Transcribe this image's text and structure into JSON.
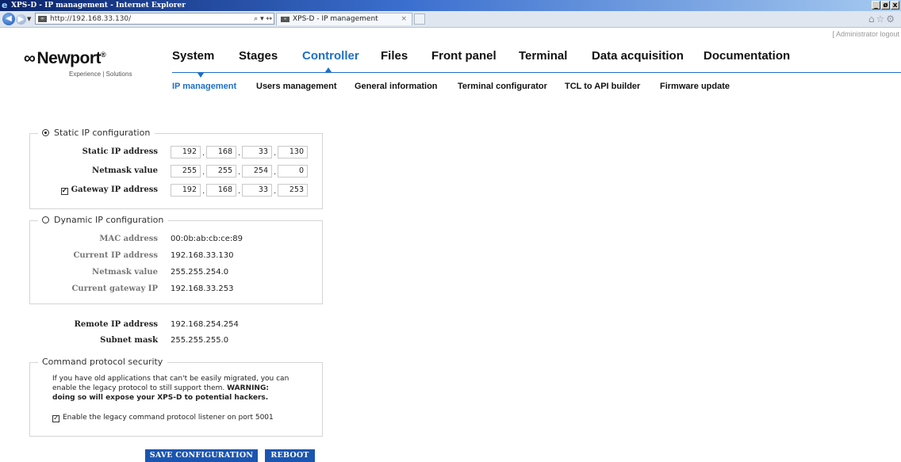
{
  "window": {
    "title": "XPS-D - IP management - Internet Explorer",
    "controls": [
      "_",
      "ø",
      "x"
    ]
  },
  "browser": {
    "address": "http://192.168.33.130/",
    "address_tools": "⌕ ▾ ↔",
    "tab_label": "XPS-D - IP management",
    "tab_close": "×",
    "right_icons": "⌂☆⚙"
  },
  "header": {
    "logout": "[ Administrator logout",
    "logo_text": "Newport",
    "logo_symbol": "∞",
    "logo_reg": "®",
    "tagline": "Experience | Solutions"
  },
  "topnav": [
    "System",
    "Stages",
    "Controller",
    "Files",
    "Front panel",
    "Terminal",
    "Data acquisition",
    "Documentation"
  ],
  "topnav_active": "Controller",
  "subnav": [
    "IP management",
    "Users management",
    "General information",
    "Terminal configurator",
    "TCL to API builder",
    "Firmware update"
  ],
  "subnav_active": "IP management",
  "static": {
    "legend": "Static IP configuration",
    "selected": true,
    "ip_label": "Static IP address",
    "ip": [
      "192",
      "168",
      "33",
      "130"
    ],
    "netmask_label": "Netmask value",
    "netmask": [
      "255",
      "255",
      "254",
      "0"
    ],
    "gateway_label": "Gateway IP address",
    "gateway_checked": true,
    "gateway": [
      "192",
      "168",
      "33",
      "253"
    ]
  },
  "dynamic": {
    "legend": "Dynamic IP configuration",
    "selected": false,
    "mac_label": "MAC address",
    "mac": "00:0b:ab:cb:ce:89",
    "current_ip_label": "Current IP address",
    "current_ip": "192.168.33.130",
    "netmask_label": "Netmask value",
    "netmask": "255.255.254.0",
    "gateway_label": "Current gateway IP",
    "gateway": "192.168.33.253"
  },
  "remote": {
    "remote_label": "Remote IP address",
    "remote_ip": "192.168.254.254",
    "subnet_label": "Subnet mask",
    "subnet": "255.255.255.0"
  },
  "security": {
    "legend": "Command protocol security",
    "line1": "If you have old applications that can't be easily migrated, you can",
    "line2_a": "enable the legacy protocol to still support them. ",
    "line2_b": "WARNING:",
    "line3": "doing so will expose your XPS-D to potential hackers.",
    "legacy_label": "Enable the legacy command protocol listener on port 5001",
    "legacy_checked": true
  },
  "buttons": {
    "save": "SAVE CONFIGURATION",
    "reboot": "REBOOT"
  },
  "colors": {
    "accent": "#1e6fc8",
    "button": "#1a55b0"
  }
}
